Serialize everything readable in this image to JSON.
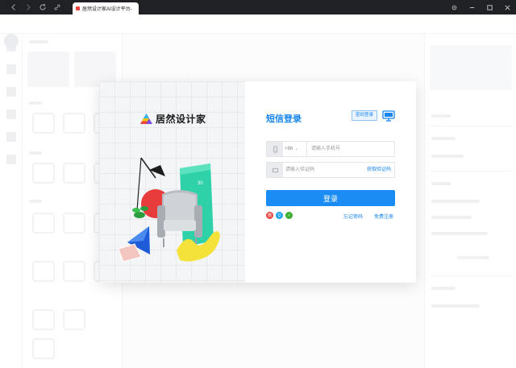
{
  "browser": {
    "tab_title": "居然设计家AI设计平台-",
    "tab_close": "×"
  },
  "modal": {
    "brand_name": "居然设计家",
    "login_title": "短信登录",
    "qr_tip": "密码登录",
    "phone": {
      "country_code": "+86",
      "placeholder": "请输入手机号"
    },
    "code": {
      "placeholder": "请输入验证码",
      "get_code_label": "获取验证码"
    },
    "login_button": "登录",
    "social": [
      {
        "name": "weibo-icon",
        "color": "#e8453c"
      },
      {
        "name": "qq-icon",
        "color": "#1aa3f0"
      },
      {
        "name": "wechat-icon",
        "color": "#3cb034"
      }
    ],
    "forgot_password": "忘记密码",
    "register": "免费注册"
  },
  "colors": {
    "accent": "#1785f0",
    "button": "#1a8cf3"
  }
}
